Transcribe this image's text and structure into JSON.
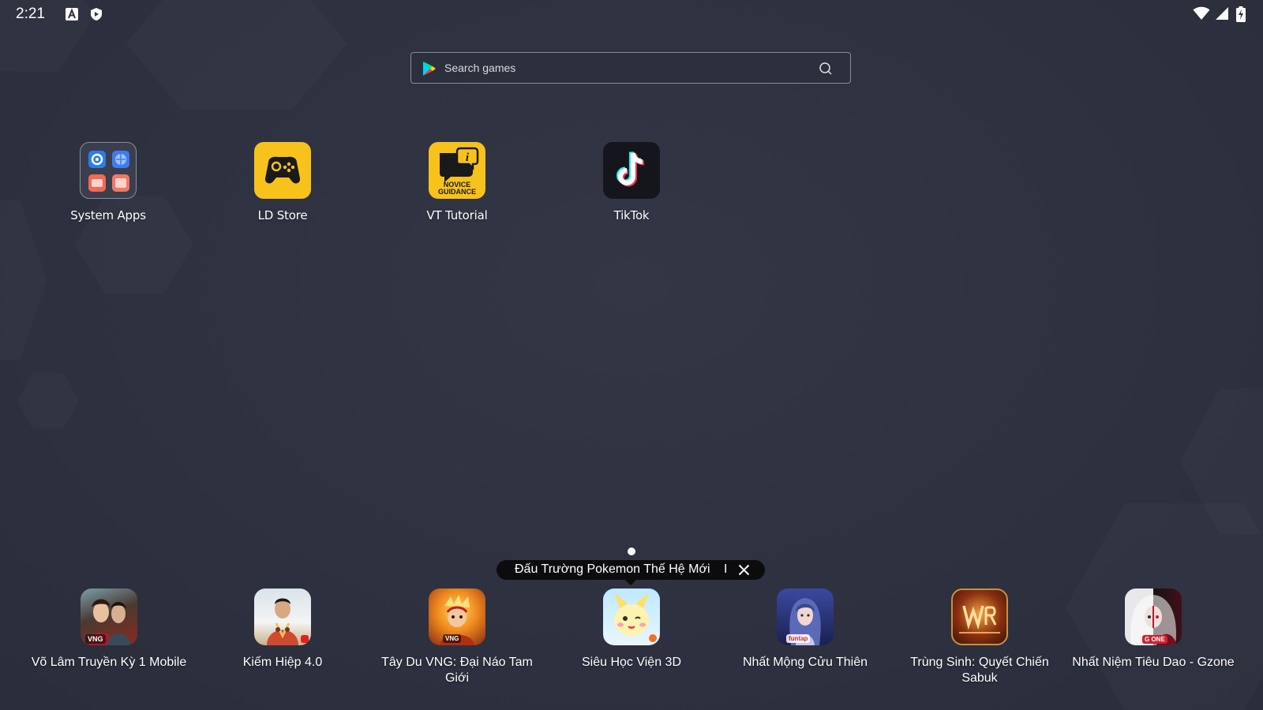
{
  "status_bar": {
    "time": "2:21"
  },
  "search": {
    "placeholder": "Search games"
  },
  "apps": [
    {
      "label": "System Apps",
      "icon": "system-apps-folder-icon"
    },
    {
      "label": "LD Store",
      "icon": "gamepad-icon",
      "color": "#f7c21b"
    },
    {
      "label": "VT Tutorial",
      "icon": "novice-guidance-icon",
      "color": "#f7c21b",
      "icon_text_1": "NOVICE",
      "icon_text_2": "GUIDANCE"
    },
    {
      "label": "TikTok",
      "icon": "tiktok-icon",
      "color": "#15161b"
    }
  ],
  "promo": {
    "text": "Đấu Trường Pokemon Thế Hệ Mới",
    "separator": "I"
  },
  "dock": [
    {
      "label": "Võ Lâm Truyền Kỳ 1 Mobile",
      "icon": "vo-lam-game-icon"
    },
    {
      "label": "Kiếm Hiệp 4.0",
      "icon": "kiem-hiep-game-icon"
    },
    {
      "label": "Tây Du VNG: Đại Náo Tam Giới",
      "icon": "tay-du-game-icon"
    },
    {
      "label": "Siêu Học Viện 3D",
      "icon": "sieu-hoc-vien-game-icon"
    },
    {
      "label": "Nhất Mộng Cửu Thiên",
      "icon": "nhat-mong-game-icon"
    },
    {
      "label": "Trùng Sinh: Quyết Chiến Sabuk",
      "icon": "trung-sinh-game-icon"
    },
    {
      "label": "Nhất Niệm Tiêu Dao - Gzone",
      "icon": "nhat-niem-game-icon"
    }
  ]
}
